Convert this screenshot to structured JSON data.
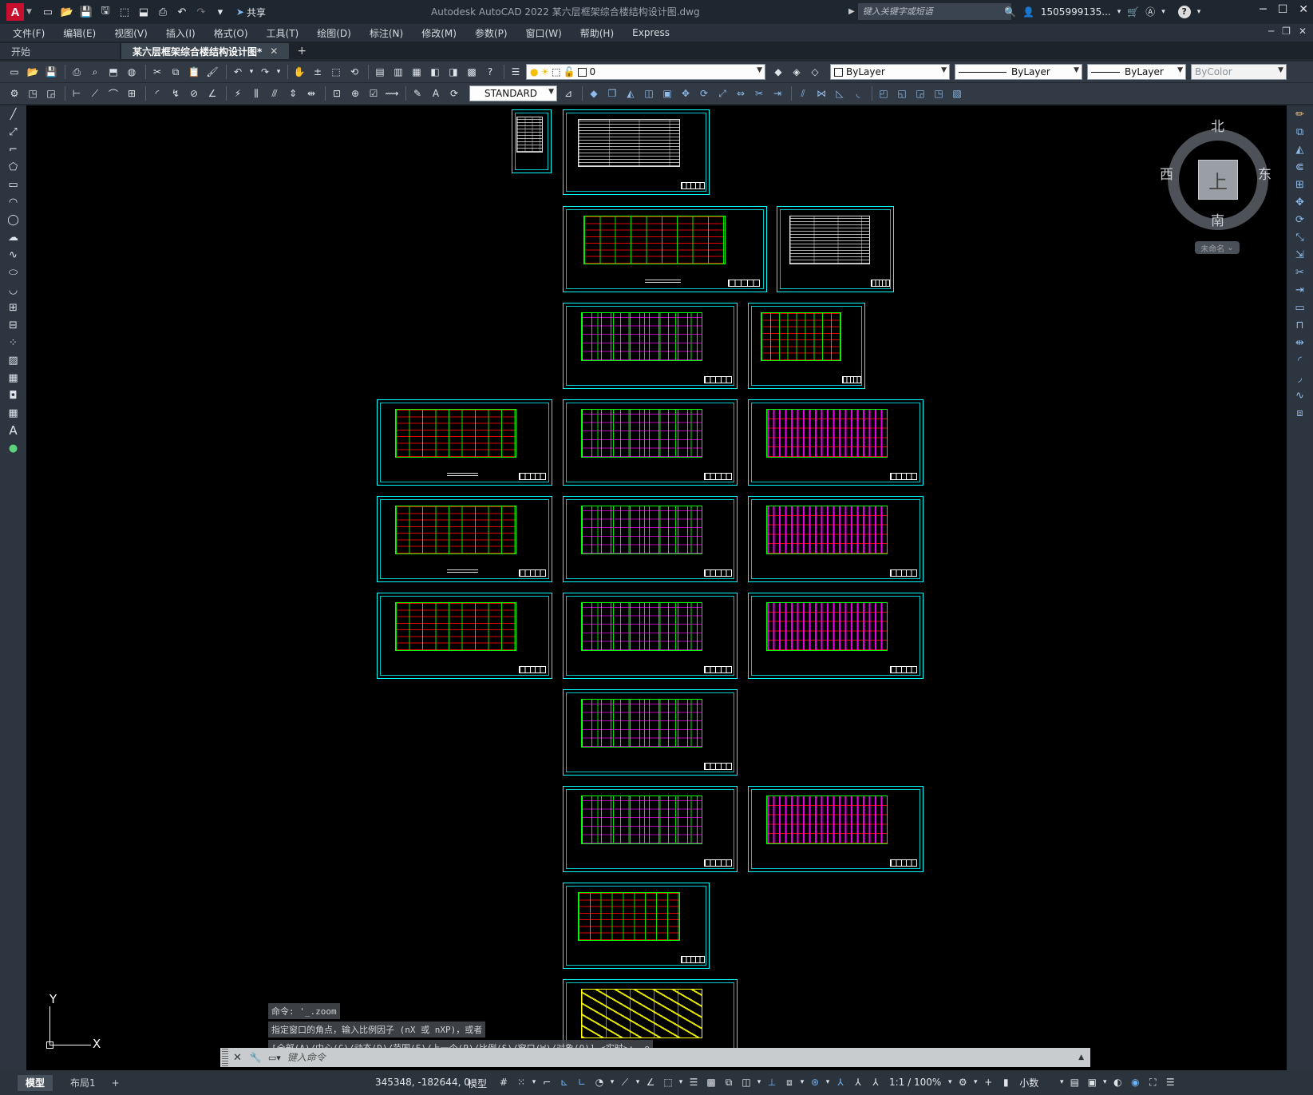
{
  "app": {
    "window_title": "Autodesk AutoCAD 2022    某六层框架综合楼结构设计图.dwg",
    "logo_letter": "A",
    "share_label": "共享",
    "search_placeholder": "键入关键字或短语",
    "user_name": "1505999135...",
    "help_label": "?"
  },
  "menu": {
    "items": [
      "文件(F)",
      "编辑(E)",
      "视图(V)",
      "插入(I)",
      "格式(O)",
      "工具(T)",
      "绘图(D)",
      "标注(N)",
      "修改(M)",
      "参数(P)",
      "窗口(W)",
      "帮助(H)",
      "Express"
    ]
  },
  "tabs": {
    "start": "开始",
    "document": "某六层框架综合楼结构设计图*",
    "close_glyph": "✕",
    "add_glyph": "+"
  },
  "toolbar": {
    "layer_value": "0",
    "text_style": "STANDARD",
    "color": "ByLayer",
    "linetype": "ByLayer",
    "lineweight": "ByLayer",
    "plotstyle": "ByColor"
  },
  "viewcube": {
    "top_face": "上",
    "north": "北",
    "south": "南",
    "west": "西",
    "east": "东",
    "ucs_name": "未命名"
  },
  "ucs": {
    "x_label": "X",
    "y_label": "Y"
  },
  "command": {
    "history": [
      "命令: '_.zoom",
      "指定窗口的角点，输入比例因子 (nX 或 nXP)，或者",
      "[全部(A)/中心(C)/动态(D)/范围(E)/上一个(P)/比例(S)/窗口(W)/对象(O)] <实时>: _e"
    ],
    "input_placeholder": "键入命令"
  },
  "status": {
    "model_tab": "模型",
    "layout_tab": "布局1",
    "add_layout": "+",
    "coordinates": "345348, -182644, 0",
    "space": "模型",
    "scale": "1:1 / 100%",
    "units": "小数"
  },
  "colors": {
    "sheet_border": "#00ffff",
    "canvas_bg": "#000000",
    "ui_bg": "#212830",
    "status_active": "#6fb3f2"
  }
}
